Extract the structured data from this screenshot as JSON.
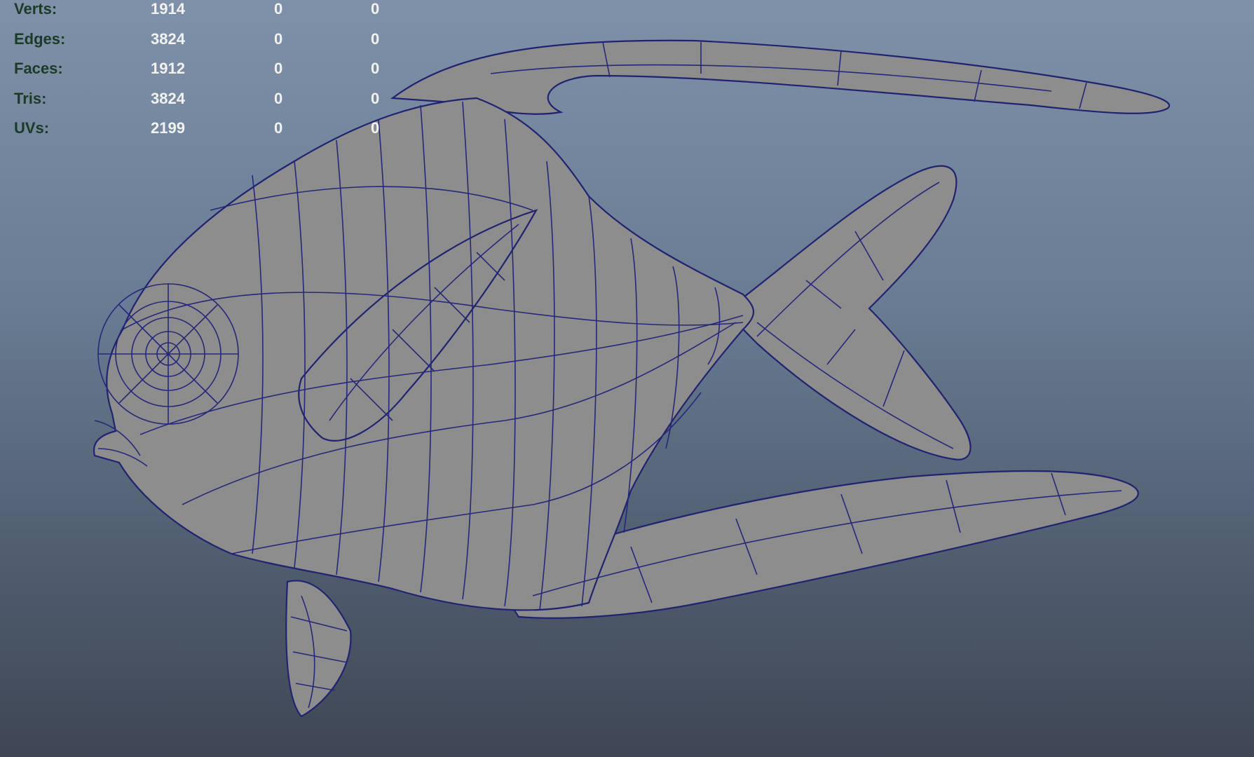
{
  "hud": {
    "rows": [
      {
        "label": "Verts:",
        "total": "1914",
        "selected": "0",
        "uv": "0"
      },
      {
        "label": "Edges:",
        "total": "3824",
        "selected": "0",
        "uv": "0"
      },
      {
        "label": "Faces:",
        "total": "1912",
        "selected": "0",
        "uv": "0"
      },
      {
        "label": "Tris:",
        "total": "3824",
        "selected": "0",
        "uv": "0"
      },
      {
        "label": "UVs:",
        "total": "2199",
        "selected": "0",
        "uv": "0"
      }
    ]
  },
  "colors": {
    "viewport_top": "#7f91a9",
    "viewport_bottom": "#3e4654",
    "mesh_fill": "#8c8c8c",
    "wireframe": "#25287a",
    "hud_label": "#1a3c26",
    "hud_value": "#f0f0f0"
  },
  "scene": {
    "object_icon": "fish-mesh-icon"
  }
}
